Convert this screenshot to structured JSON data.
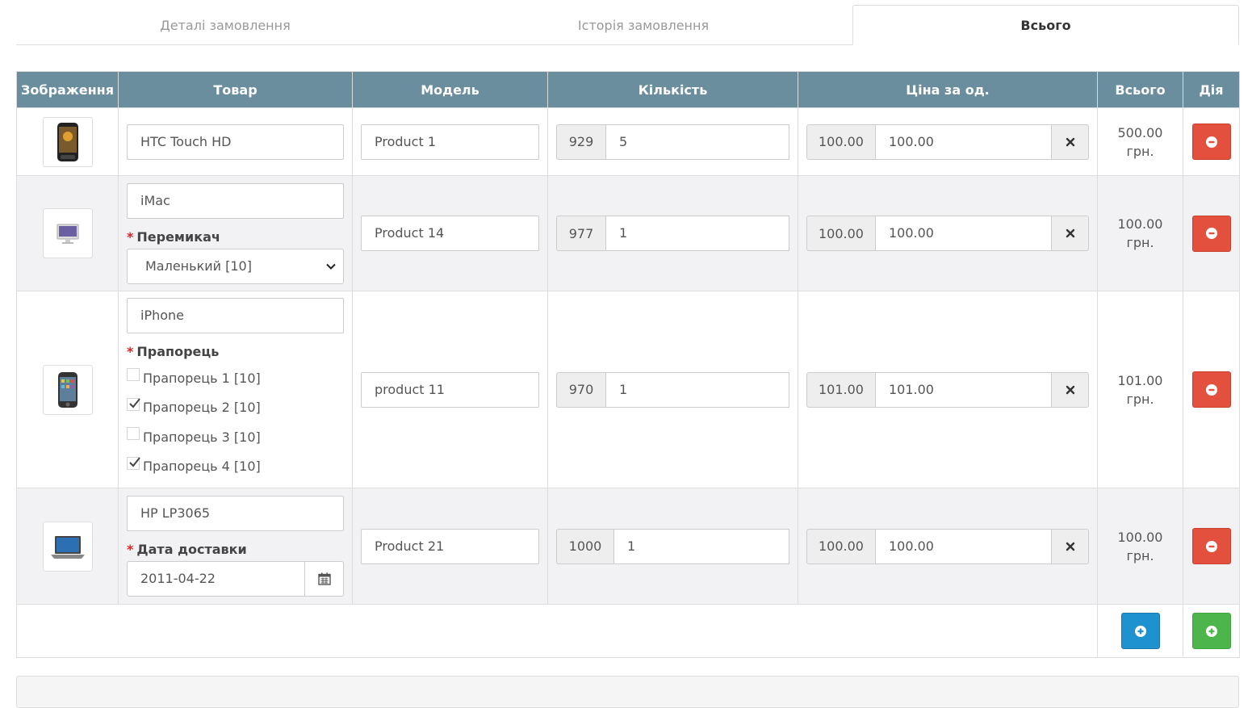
{
  "tabs": [
    {
      "label": "Деталі замовлення",
      "active": false
    },
    {
      "label": "Історія замовлення",
      "active": false
    },
    {
      "label": "Всього",
      "active": true
    }
  ],
  "table": {
    "headers": {
      "image": "Зображення",
      "product": "Товар",
      "model": "Модель",
      "quantity": "Кількість",
      "unit_price": "Ціна за од.",
      "total": "Всього",
      "action": "Дія"
    },
    "rows": [
      {
        "image_icon": "phone-thumbnail-icon",
        "name": "HTC Touch HD",
        "model": "Product 1",
        "stock": "929",
        "quantity": "5",
        "base_price": "100.00",
        "price": "100.00",
        "total": "500.00",
        "currency": "грн."
      },
      {
        "image_icon": "imac-thumbnail-icon",
        "name": "iMac",
        "option_label": "Перемикач",
        "option_select": "Маленький [10]",
        "model": "Product 14",
        "stock": "977",
        "quantity": "1",
        "base_price": "100.00",
        "price": "100.00",
        "total": "100.00",
        "currency": "грн."
      },
      {
        "image_icon": "iphone-thumbnail-icon",
        "name": "iPhone",
        "option_label": "Прапорець",
        "checkboxes": [
          {
            "label": "Прапорець 1 [10]",
            "checked": false
          },
          {
            "label": "Прапорець 2 [10]",
            "checked": true
          },
          {
            "label": "Прапорець 3 [10]",
            "checked": false
          },
          {
            "label": "Прапорець 4 [10]",
            "checked": true
          }
        ],
        "model": "product 11",
        "stock": "970",
        "quantity": "1",
        "base_price": "101.00",
        "price": "101.00",
        "total": "101.00",
        "currency": "грн."
      },
      {
        "image_icon": "laptop-thumbnail-icon",
        "name": "HP LP3065",
        "option_label": "Дата доставки",
        "date_value": "2011-04-22",
        "model": "Product 21",
        "stock": "1000",
        "quantity": "1",
        "base_price": "100.00",
        "price": "100.00",
        "total": "100.00",
        "currency": "грн."
      }
    ]
  },
  "colors": {
    "header_bg": "#6b8e9e",
    "danger": "#e3503e",
    "primary": "#1e91cf",
    "success": "#4cb64c",
    "required": "#dd2222"
  }
}
